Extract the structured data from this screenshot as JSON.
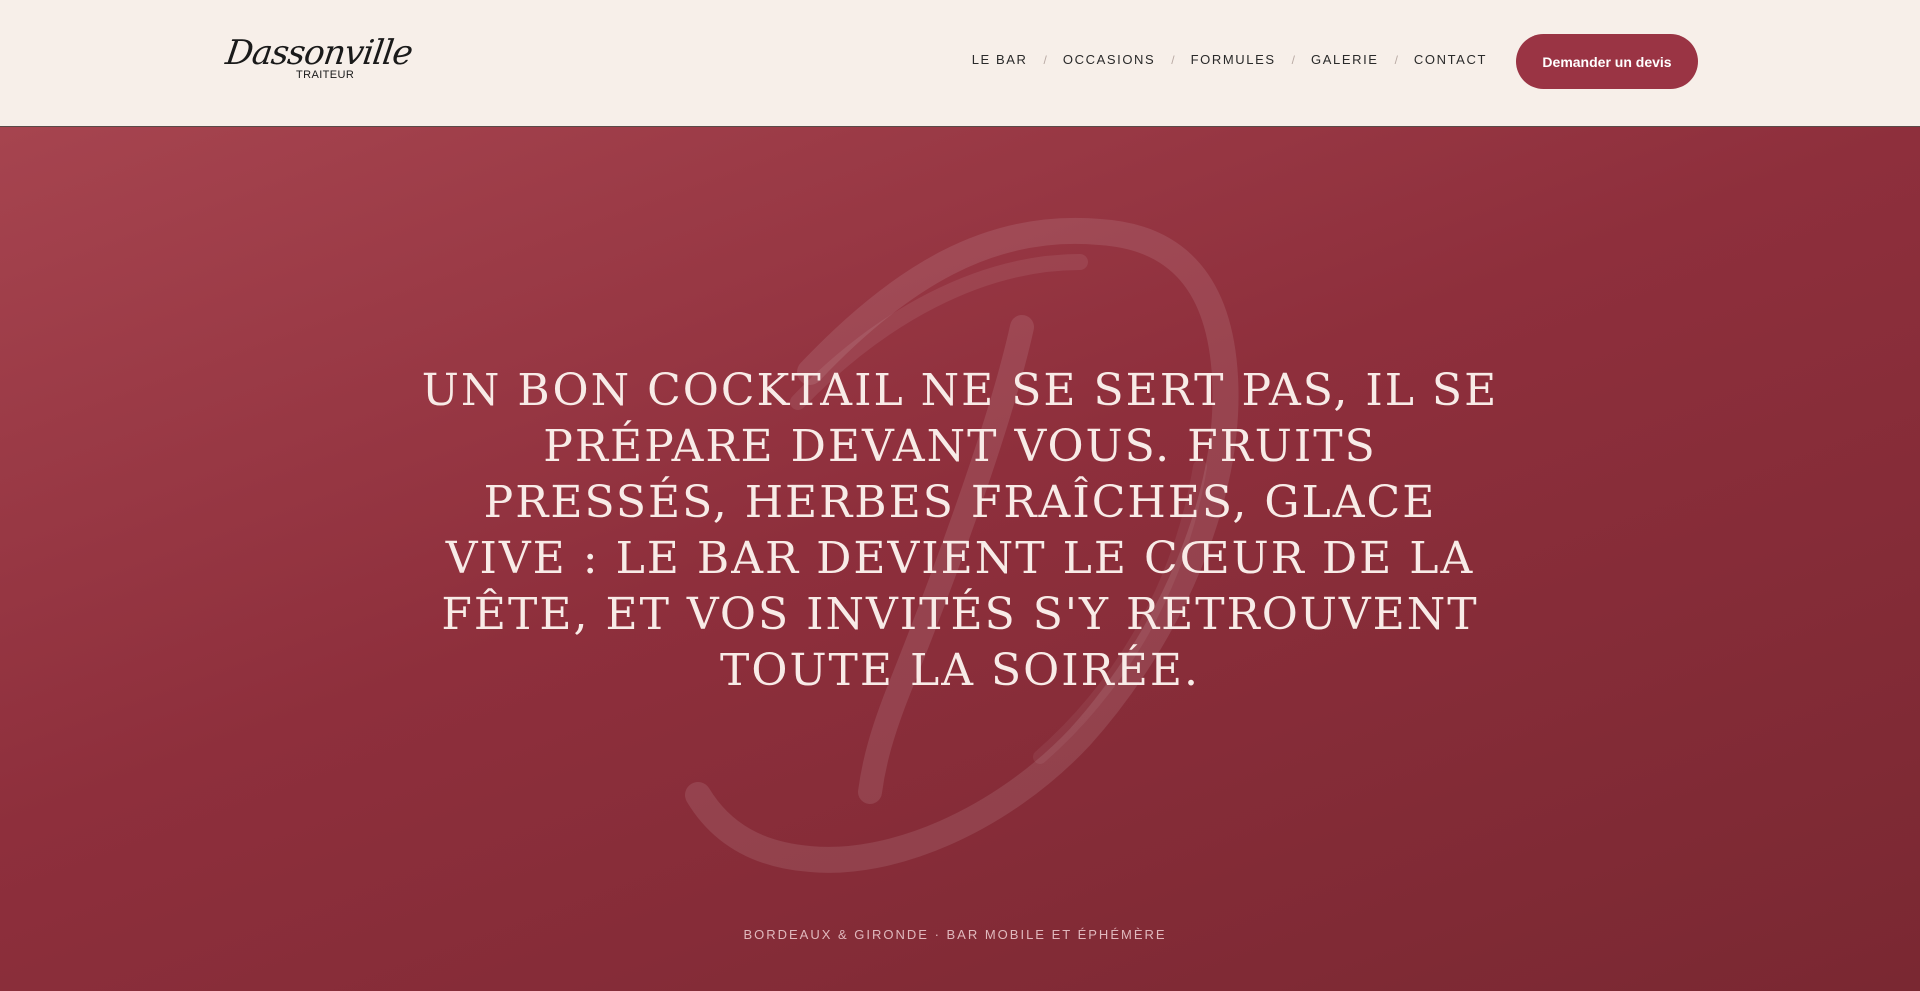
{
  "header": {
    "logo": {
      "script": "Dassonville",
      "sub": "TRAITEUR"
    },
    "nav": [
      {
        "label": "LE BAR"
      },
      {
        "label": "OCCASIONS"
      },
      {
        "label": "FORMULES"
      },
      {
        "label": "GALERIE"
      },
      {
        "label": "CONTACT"
      }
    ],
    "nav_separator": "/",
    "cta_label": "Demander un devis"
  },
  "hero": {
    "quote": "UN BON COCKTAIL NE SE SERT PAS, IL SE PRÉPARE DEVANT VOUS. FRUITS PRESSÉS, HERBES FRAÎCHES, GLACE VIVE : LE BAR DEVIENT LE CŒUR DE LA FÊTE, ET VOS INVITÉS S'Y RETROUVENT TOUTE LA SOIRÉE.",
    "tagline": "BORDEAUX & GIRONDE · BAR MOBILE ET ÉPHÉMÈRE",
    "watermark_icon": "brush-letter-d-icon"
  },
  "colors": {
    "header_bg": "#f7efe9",
    "accent": "#9a3444",
    "hero_gradient_start": "#a6444f",
    "hero_gradient_end": "#7a2832",
    "hero_text": "#f8ebe7"
  }
}
